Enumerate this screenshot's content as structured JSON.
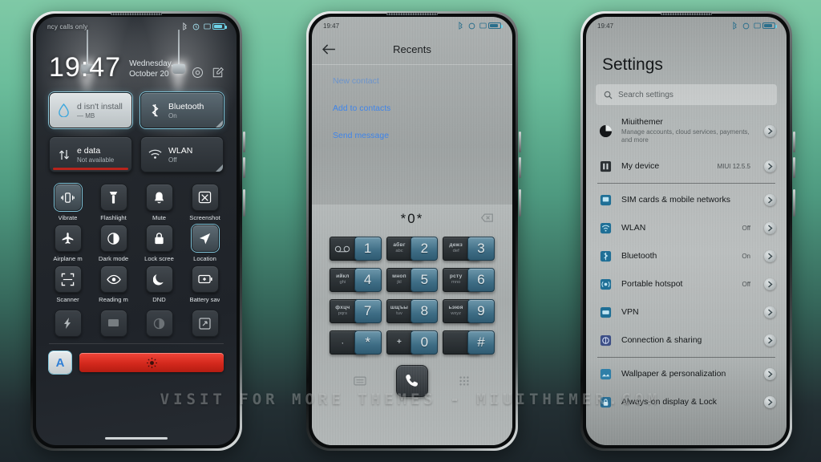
{
  "watermark": "VISIT FOR MORE THEMES - MIUITHEMER.COM",
  "theme": {
    "accent": "#7fc3d8",
    "link": "#3f84e8",
    "slider_red": "#d3281c",
    "bg_top": "#7fc9a6",
    "bg_bottom": "#1d262b"
  },
  "phone1": {
    "status": {
      "carrier": "ncy calls only",
      "icons": [
        "bluetooth-icon",
        "alarm-icon",
        "screenshot-icon",
        "battery-icon"
      ]
    },
    "clock": {
      "time": "19:47",
      "date": "Wednesday, October 20"
    },
    "header_actions": [
      "settings-gear-icon",
      "edit-icon"
    ],
    "big_tiles": [
      {
        "title": "d isn't install",
        "sub": "— MB",
        "icon": "data-drop-icon",
        "state": "pale"
      },
      {
        "title": "Bluetooth",
        "sub": "On",
        "icon": "bluetooth-icon",
        "state": "lit"
      },
      {
        "title": "e data",
        "sub": "Not available",
        "icon": "mobile-data-icon",
        "state": "off"
      },
      {
        "title": "WLAN",
        "sub": "Off",
        "icon": "wifi-icon",
        "state": "off"
      }
    ],
    "quick_tiles": [
      {
        "label": "Vibrate",
        "icon": "vibrate-icon",
        "on": true
      },
      {
        "label": "Flashlight",
        "icon": "flashlight-icon",
        "on": false
      },
      {
        "label": "Mute",
        "icon": "bell-icon",
        "on": false
      },
      {
        "label": "Screenshot",
        "icon": "screenshot-icon",
        "on": false
      },
      {
        "label": "Airplane m",
        "icon": "airplane-icon",
        "on": false
      },
      {
        "label": "Dark mode",
        "icon": "dark-mode-icon",
        "on": false
      },
      {
        "label": "Lock scree",
        "icon": "lock-icon",
        "on": false
      },
      {
        "label": "Location",
        "icon": "location-icon",
        "on": true
      },
      {
        "label": "Scanner",
        "icon": "scanner-icon",
        "on": false
      },
      {
        "label": "Reading m",
        "icon": "eye-icon",
        "on": false
      },
      {
        "label": "DND",
        "icon": "moon-icon",
        "on": false
      },
      {
        "label": "Battery sav",
        "icon": "battery-saver-icon",
        "on": false
      }
    ],
    "extra_tiles": [
      "bolt-icon",
      "cast-icon",
      "sync-icon",
      "expand-icon"
    ],
    "brightness": {
      "auto_label": "A",
      "slider_icon": "brightness-icon"
    }
  },
  "phone2": {
    "status": {
      "time": "19:47",
      "icons": [
        "bluetooth-icon",
        "alarm-icon",
        "screenshot-icon",
        "battery-icon"
      ]
    },
    "title": "Recents",
    "back_icon": "back-arrow-icon",
    "links": [
      "New contact",
      "Add to contacts",
      "Send message"
    ],
    "dialpad": {
      "number": "*0*",
      "delete_icon": "backspace-icon",
      "keys": [
        {
          "digit": "1",
          "cyrillic": "",
          "latin": "",
          "icon": "voicemail-icon"
        },
        {
          "digit": "2",
          "cyrillic": "абвг",
          "latin": "abc",
          "icon": ""
        },
        {
          "digit": "3",
          "cyrillic": "дежз",
          "latin": "def",
          "icon": ""
        },
        {
          "digit": "4",
          "cyrillic": "ийкл",
          "latin": "ghi",
          "icon": ""
        },
        {
          "digit": "5",
          "cyrillic": "мноп",
          "latin": "jkl",
          "icon": ""
        },
        {
          "digit": "6",
          "cyrillic": "рсту",
          "latin": "mno",
          "icon": ""
        },
        {
          "digit": "7",
          "cyrillic": "фхцч",
          "latin": "pqrs",
          "icon": ""
        },
        {
          "digit": "8",
          "cyrillic": "шщъы",
          "latin": "tuv",
          "icon": ""
        },
        {
          "digit": "9",
          "cyrillic": "ьэюя",
          "latin": "wxyz",
          "icon": ""
        },
        {
          "digit": "*",
          "cyrillic": "",
          "latin": ",",
          "icon": ""
        },
        {
          "digit": "0",
          "cyrillic": "",
          "latin": "+",
          "icon": ""
        },
        {
          "digit": "#",
          "cyrillic": "",
          "latin": "",
          "icon": ""
        }
      ],
      "bottom": [
        "keyboard-icon",
        "call-icon",
        "dialpad-icon"
      ]
    }
  },
  "phone3": {
    "status": {
      "time": "19:47",
      "icons": [
        "bluetooth-icon",
        "alarm-icon",
        "screenshot-icon",
        "battery-icon"
      ]
    },
    "title": "Settings",
    "search_placeholder": "Search settings",
    "search_icon": "search-icon",
    "items": [
      {
        "label": "Miuithemer",
        "sub": "Manage accounts, cloud services, payments, and more",
        "value": "",
        "icon": "account-avatar-icon"
      },
      {
        "label": "My device",
        "sub": "",
        "value": "MIUI 12.5.5",
        "icon": "device-icon"
      },
      {
        "label": "SIM cards & mobile networks",
        "sub": "",
        "value": "",
        "icon": "sim-icon"
      },
      {
        "label": "WLAN",
        "sub": "",
        "value": "Off",
        "icon": "wifi-icon"
      },
      {
        "label": "Bluetooth",
        "sub": "",
        "value": "On",
        "icon": "bluetooth-icon"
      },
      {
        "label": "Portable hotspot",
        "sub": "",
        "value": "Off",
        "icon": "hotspot-icon"
      },
      {
        "label": "VPN",
        "sub": "",
        "value": "",
        "icon": "vpn-icon"
      },
      {
        "label": "Connection & sharing",
        "sub": "",
        "value": "",
        "icon": "connection-icon"
      },
      {
        "label": "Wallpaper & personalization",
        "sub": "",
        "value": "",
        "icon": "wallpaper-icon"
      },
      {
        "label": "Always-on display & Lock",
        "sub": "",
        "value": "",
        "icon": "aod-lock-icon"
      }
    ]
  }
}
